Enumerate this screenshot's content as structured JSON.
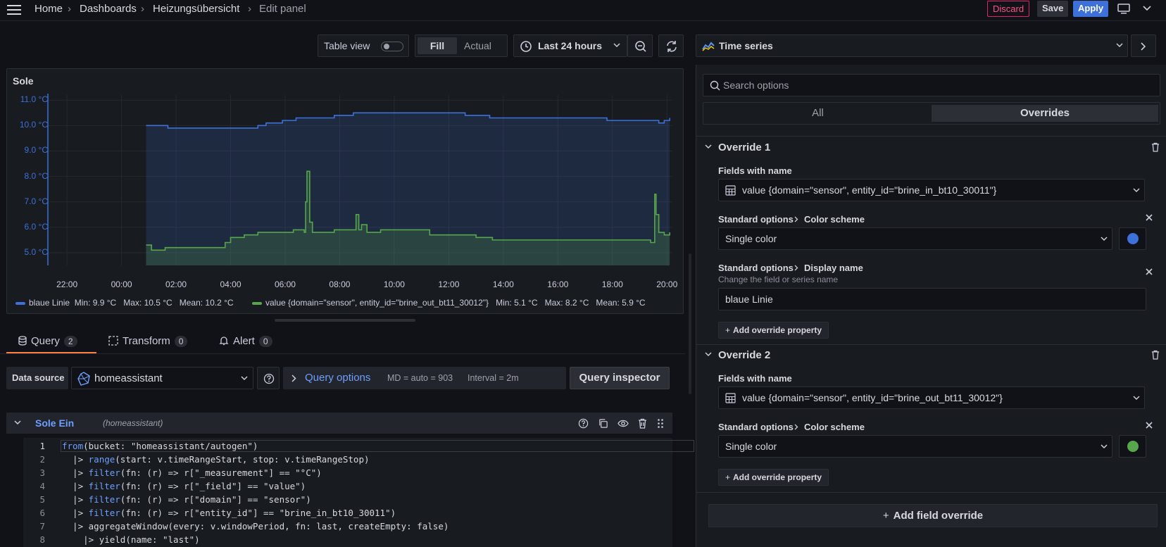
{
  "breadcrumb": {
    "home": "Home",
    "dashboards": "Dashboards",
    "dashboard": "Heizungsübersicht",
    "current": "Edit panel",
    "sep": "›"
  },
  "toolbar": {
    "discard": "Discard",
    "save": "Save",
    "apply": "Apply"
  },
  "panel_toolbar": {
    "table_view": "Table view",
    "fill": "Fill",
    "actual": "Actual",
    "time_range": "Last 24 hours"
  },
  "visualization": {
    "name": "Time series"
  },
  "panel": {
    "title": "Sole",
    "y_ticks": [
      "11.0 °C",
      "10.0 °C",
      "9.0 °C",
      "8.0 °C",
      "7.0 °C",
      "6.0 °C",
      "5.0 °C"
    ],
    "x_ticks": [
      "22:00",
      "00:00",
      "02:00",
      "04:00",
      "06:00",
      "08:00",
      "10:00",
      "12:00",
      "14:00",
      "16:00",
      "18:00",
      "20:00"
    ],
    "legend": [
      {
        "name": "blaue Linie",
        "min": "Min: 9.9 °C",
        "max": "Max: 10.5 °C",
        "mean": "Mean: 10.2 °C",
        "color": "#3d71d9"
      },
      {
        "name": "value {domain=\"sensor\", entity_id=\"brine_out_bt11_30012\"}",
        "min": "Min: 5.1 °C",
        "max": "Max: 8.2 °C",
        "mean": "Mean: 5.9 °C",
        "color": "#56a64b"
      }
    ]
  },
  "chart_data": {
    "type": "line",
    "ylim": [
      4.5,
      11.2
    ],
    "x_ticks": [
      "22:00",
      "00:00",
      "02:00",
      "04:00",
      "06:00",
      "08:00",
      "10:00",
      "12:00",
      "14:00",
      "16:00",
      "18:00",
      "20:00"
    ],
    "series": [
      {
        "name": "blaue Linie",
        "color": "#3d71d9",
        "x": [
          0.9,
          1.7,
          4.5,
          5.0,
          5.3,
          5.6,
          5.9,
          6.4,
          7.2,
          7.8,
          8.1,
          8.5,
          9.2,
          9.5,
          10.0,
          12.2,
          12.6,
          13.0,
          13.5,
          15.0,
          17.4,
          17.8,
          19.6,
          19.7,
          19.9,
          20.1
        ],
        "y": [
          10.0,
          9.9,
          9.9,
          10.0,
          10.1,
          10.1,
          10.2,
          10.3,
          10.3,
          10.4,
          10.4,
          10.5,
          10.5,
          10.5,
          10.5,
          10.5,
          10.4,
          10.4,
          10.3,
          10.3,
          10.3,
          10.2,
          10.2,
          10.1,
          10.2,
          10.3
        ]
      },
      {
        "name": "value {domain=\"sensor\", entity_id=\"brine_out_bt11_30012\"}",
        "color": "#56a64b",
        "x": [
          0.9,
          1.1,
          1.6,
          2.3,
          3.6,
          3.8,
          4.0,
          4.5,
          5.0,
          5.4,
          5.7,
          6.3,
          6.7,
          6.75,
          6.8,
          6.9,
          7.0,
          7.2,
          7.8,
          8.6,
          8.7,
          8.8,
          9.0,
          9.5,
          10.5,
          11.3,
          12.3,
          13.0,
          13.6,
          14.5,
          16.0,
          17.4,
          19.4,
          19.55,
          19.6,
          19.7,
          19.9,
          20.1
        ],
        "y": [
          5.3,
          5.1,
          5.2,
          5.2,
          5.2,
          5.4,
          5.6,
          5.7,
          5.8,
          5.8,
          5.8,
          5.9,
          5.8,
          7.0,
          8.2,
          6.2,
          5.8,
          5.8,
          5.9,
          6.5,
          5.9,
          6.1,
          5.8,
          5.9,
          5.9,
          5.7,
          5.7,
          5.6,
          5.5,
          5.5,
          5.5,
          5.5,
          5.4,
          7.3,
          6.5,
          5.8,
          5.7,
          5.8
        ]
      }
    ]
  },
  "query_tabs": {
    "query": "Query",
    "query_count": "2",
    "transform": "Transform",
    "transform_count": "0",
    "alert": "Alert",
    "alert_count": "0"
  },
  "datasource": {
    "label": "Data source",
    "value": "homeassistant",
    "options_label": "Query options",
    "md": "MD = auto = 903",
    "interval": "Interval = 2m",
    "inspector": "Query inspector"
  },
  "query_row": {
    "name": "Sole Ein",
    "source": "(homeassistant)"
  },
  "code_lines": [
    {
      "n": "1",
      "pre": "",
      "kw": "from",
      "rest": "(bucket: \"homeassistant/autogen\")"
    },
    {
      "n": "2",
      "pre": "  |> ",
      "kw": "range",
      "rest": "(start: v.timeRangeStart, stop: v.timeRangeStop)"
    },
    {
      "n": "3",
      "pre": "  |> ",
      "kw": "filter",
      "rest": "(fn: (r) => r[\"_measurement\"] == \"°C\")"
    },
    {
      "n": "4",
      "pre": "  |> ",
      "kw": "filter",
      "rest": "(fn: (r) => r[\"_field\"] == \"value\")"
    },
    {
      "n": "5",
      "pre": "  |> ",
      "kw": "filter",
      "rest": "(fn: (r) => r[\"domain\"] == \"sensor\")"
    },
    {
      "n": "6",
      "pre": "  |> ",
      "kw": "filter",
      "rest": "(fn: (r) => r[\"entity_id\"] == \"brine_in_bt10_30011\")"
    },
    {
      "n": "7",
      "pre": "  |> ",
      "kw": "",
      "rest": "aggregateWindow(every: v.windowPeriod, fn: last, createEmpty: false)"
    },
    {
      "n": "8",
      "pre": "    |> ",
      "kw": "",
      "rest": "yield(name: \"last\")"
    }
  ],
  "options": {
    "search_placeholder": "Search options",
    "tab_all": "All",
    "tab_overrides": "Overrides",
    "override1": {
      "title": "Override 1",
      "fields_label": "Fields with name",
      "field_value": "value {domain=\"sensor\", entity_id=\"brine_in_bt10_30011\"}",
      "prop1_label": "Standard options",
      "prop1_name": "Color scheme",
      "prop1_value": "Single color",
      "prop1_color": "#3d71d9",
      "prop2_label": "Standard options",
      "prop2_name": "Display name",
      "prop2_desc": "Change the field or series name",
      "prop2_value": "blaue Linie",
      "add_property": "Add override property"
    },
    "override2": {
      "title": "Override 2",
      "fields_label": "Fields with name",
      "field_value": "value {domain=\"sensor\", entity_id=\"brine_out_bt11_30012\"}",
      "prop1_label": "Standard options",
      "prop1_name": "Color scheme",
      "prop1_value": "Single color",
      "prop1_color": "#56a64b",
      "add_property": "Add override property"
    },
    "add_field_override": "Add field override"
  }
}
